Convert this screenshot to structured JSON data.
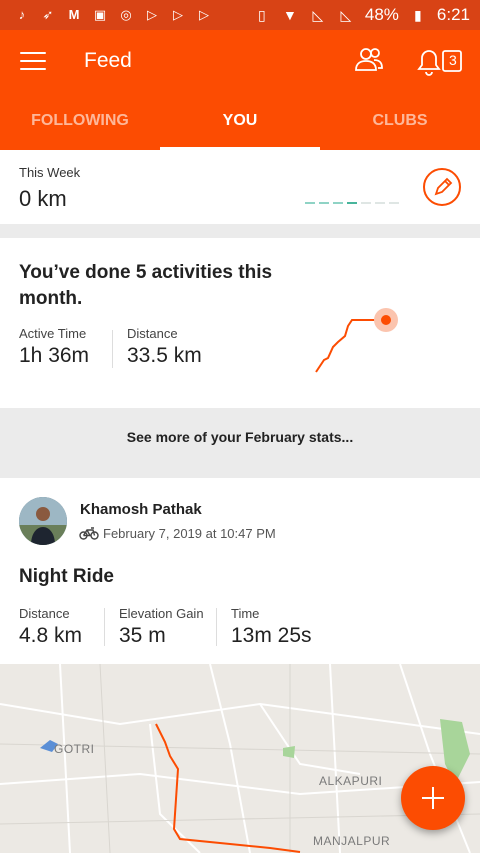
{
  "status_bar": {
    "left_icons": [
      "tiktok-icon",
      "swiftkey-icon",
      "gmail-icon",
      "gallery-icon",
      "compass-icon",
      "play-store-icon",
      "play-store-icon",
      "play-store-icon"
    ],
    "battery": "48%",
    "time": "6:21"
  },
  "app_bar": {
    "title": "Feed",
    "notification_count": "3"
  },
  "tabs": [
    {
      "label": "FOLLOWING",
      "active": false
    },
    {
      "label": "YOU",
      "active": true
    },
    {
      "label": "CLUBS",
      "active": false
    }
  ],
  "this_week": {
    "label": "This Week",
    "value": "0 km"
  },
  "month_summary": {
    "headline": "You’ve done 5 activities this month.",
    "active_time_label": "Active Time",
    "active_time_value": "1h 36m",
    "distance_label": "Distance",
    "distance_value": "33.5 km"
  },
  "see_more": "See more of your February stats...",
  "activity": {
    "athlete": "Khamosh  Pathak",
    "date": "February 7, 2019 at 10:47 PM",
    "name": "Night Ride",
    "stats": [
      {
        "label": "Distance",
        "value": "4.8 km"
      },
      {
        "label": "Elevation Gain",
        "value": "35 m"
      },
      {
        "label": "Time",
        "value": "13m 25s"
      }
    ]
  },
  "map": {
    "labels": [
      "GOTRI",
      "ALKAPURI",
      "MANJALPUR"
    ]
  },
  "colors": {
    "brand": "#fc4c02",
    "status_bar": "#d84315"
  }
}
